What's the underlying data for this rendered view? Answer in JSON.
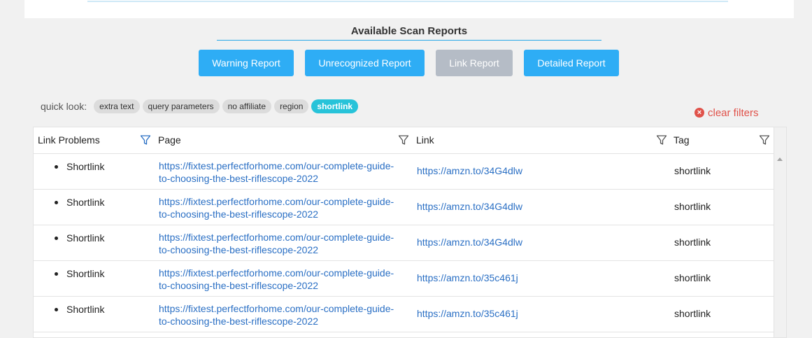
{
  "section": {
    "title": "Available Scan Reports"
  },
  "reports": [
    {
      "label": "Warning Report",
      "disabled": false
    },
    {
      "label": "Unrecognized Report",
      "disabled": false
    },
    {
      "label": "Link Report",
      "disabled": true
    },
    {
      "label": "Detailed Report",
      "disabled": false
    }
  ],
  "quick_look": {
    "label": "quick look:",
    "chips": [
      {
        "label": "extra text",
        "active": false
      },
      {
        "label": "query parameters",
        "active": false
      },
      {
        "label": "no affiliate",
        "active": false
      },
      {
        "label": "region",
        "active": false
      },
      {
        "label": "shortlink",
        "active": true
      }
    ]
  },
  "clear_filters": {
    "label": "clear filters",
    "icon": "close-circle-icon",
    "color": "#e0524a"
  },
  "table": {
    "columns": [
      "Link Problems",
      "Page",
      "Link",
      "Tag"
    ],
    "rows": [
      {
        "problem": "Shortlink",
        "page_line1": "https://fixtest.perfectforhome.com/our-complete-guide-",
        "page_line2": "to-choosing-the-best-riflescope-2022",
        "link": "https://amzn.to/34G4dlw",
        "tag": "shortlink"
      },
      {
        "problem": "Shortlink",
        "page_line1": "https://fixtest.perfectforhome.com/our-complete-guide-",
        "page_line2": "to-choosing-the-best-riflescope-2022",
        "link": "https://amzn.to/34G4dlw",
        "tag": "shortlink"
      },
      {
        "problem": "Shortlink",
        "page_line1": "https://fixtest.perfectforhome.com/our-complete-guide-",
        "page_line2": "to-choosing-the-best-riflescope-2022",
        "link": "https://amzn.to/34G4dlw",
        "tag": "shortlink"
      },
      {
        "problem": "Shortlink",
        "page_line1": "https://fixtest.perfectforhome.com/our-complete-guide-",
        "page_line2": "to-choosing-the-best-riflescope-2022",
        "link": "https://amzn.to/35c461j",
        "tag": "shortlink"
      },
      {
        "problem": "Shortlink",
        "page_line1": "https://fixtest.perfectforhome.com/our-complete-guide-",
        "page_line2": "to-choosing-the-best-riflescope-2022",
        "link": "https://amzn.to/35c461j",
        "tag": "shortlink"
      }
    ]
  },
  "colors": {
    "accent": "#2eadf5",
    "disabled": "#b5bcc6",
    "active_chip": "#27c3d9",
    "link": "#2a6fc4"
  }
}
